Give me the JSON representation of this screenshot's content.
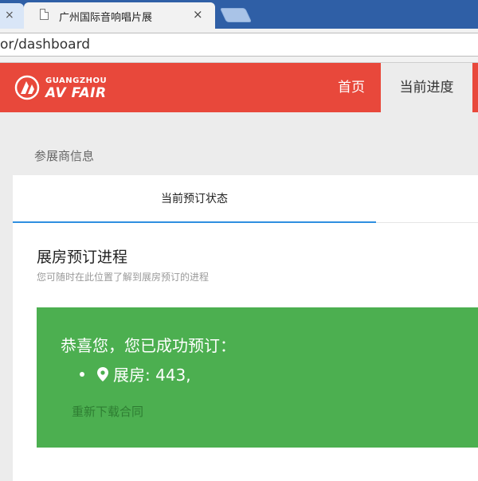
{
  "browser": {
    "prev_tab_close": "×",
    "active_tab_title": "广州国际音响唱片展",
    "active_tab_close": "×",
    "url": "or/dashboard"
  },
  "site": {
    "logo_line1": "GUANGZHOU",
    "logo_line2": "AV FAIR",
    "nav": {
      "home": "首页",
      "progress": "当前进度"
    }
  },
  "page": {
    "section_title": "参展商信息",
    "tab_label": "当前预订状态",
    "heading": "展房预订进程",
    "subheading": "您可随时在此位置了解到展房预订的进程",
    "alert": {
      "message": "恭喜您，您已成功预订：",
      "room_item": "展房: 443,",
      "redownload_link": "重新下载合同"
    }
  },
  "colors": {
    "tabstrip": "#2f5fa6",
    "header_red": "#e8483b",
    "success_green": "#4caf50",
    "active_tab_underline": "#2f8fe0"
  }
}
